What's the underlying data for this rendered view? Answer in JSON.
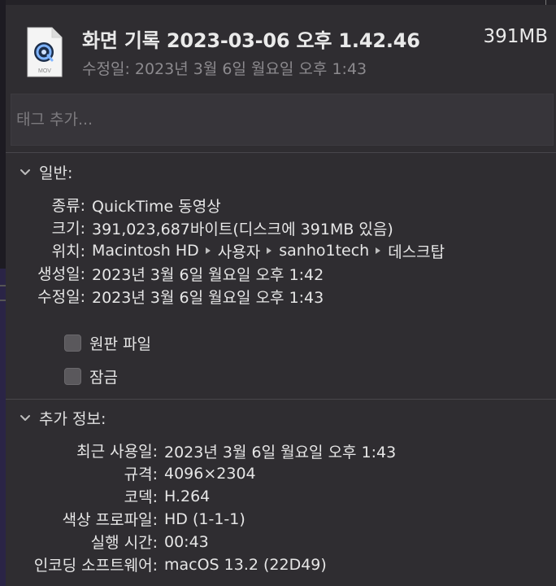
{
  "header": {
    "file_icon_label": "MOV",
    "title": "화면 기록 2023-03-06 오후 1.42.46",
    "size": "391MB",
    "modified": "수정일: 2023년 3월 6일 월요일 오후 1:43"
  },
  "tags": {
    "placeholder": "태그 추가..."
  },
  "general": {
    "heading": "일반:",
    "rows": [
      {
        "key": "종류:",
        "value": "QuickTime 동영상"
      },
      {
        "key": "크기:",
        "value": "391,023,687바이트(디스크에 391MB 있음)"
      },
      {
        "key": "위치:",
        "path": [
          "Macintosh HD",
          "사용자",
          "sanho1tech",
          "데스크탑"
        ]
      },
      {
        "key": "생성일:",
        "value": "2023년 3월 6일 월요일 오후 1:42"
      },
      {
        "key": "수정일:",
        "value": "2023년 3월 6일 월요일 오후 1:43"
      }
    ],
    "stationery_label": "원판 파일",
    "locked_label": "잠금"
  },
  "more_info": {
    "heading": "추가 정보:",
    "rows": [
      {
        "key": "최근 사용일:",
        "value": "2023년 3월 6일 월요일 오후 1:43"
      },
      {
        "key": "규격:",
        "value": "4096×2304"
      },
      {
        "key": "코덱:",
        "value": "H.264"
      },
      {
        "key": "색상 프로파일:",
        "value": "HD (1-1-1)"
      },
      {
        "key": "실행 시간:",
        "value": "00:43"
      },
      {
        "key": "인코딩 소프트웨어:",
        "value": "macOS 13.2 (22D49)"
      }
    ]
  },
  "icons": [
    "quicktime-file-icon",
    "chevron-down-icon",
    "path-arrow-icon"
  ],
  "colors": {
    "panel": "#2f2d31",
    "text": "#e6e6e6",
    "secondary": "#8c8a8e",
    "field": "#37353a"
  }
}
